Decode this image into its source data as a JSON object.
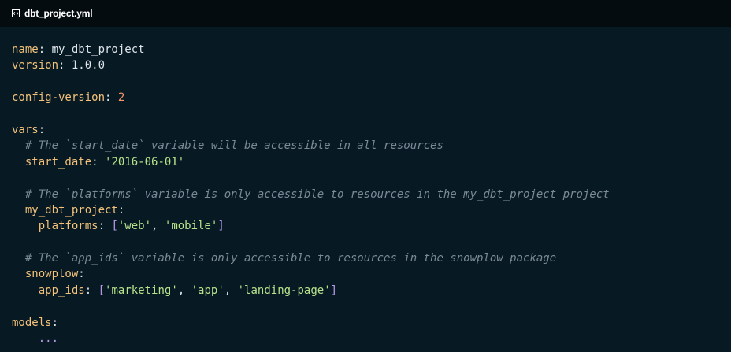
{
  "tab": {
    "icon": "code-file-icon",
    "filename": "dbt_project.yml"
  },
  "code": {
    "name_key": "name",
    "name_value": "my_dbt_project",
    "version_key": "version",
    "version_value": "1.0.0",
    "config_version_key": "config-version",
    "config_version_value": "2",
    "vars_key": "vars",
    "comment_start_date": "# The `start_date` variable will be accessible in all resources",
    "start_date_key": "start_date",
    "start_date_value": "'2016-06-01'",
    "comment_platforms": "# The `platforms` variable is only accessible to resources in the my_dbt_project project",
    "project_key": "my_dbt_project",
    "platforms_key": "platforms",
    "platforms_values": [
      "'web'",
      "'mobile'"
    ],
    "comment_app_ids": "# The `app_ids` variable is only accessible to resources in the snowplow package",
    "snowplow_key": "snowplow",
    "app_ids_key": "app_ids",
    "app_ids_values": [
      "'marketing'",
      "'app'",
      "'landing-page'"
    ],
    "models_key": "models",
    "ellipsis": "..."
  },
  "colors": {
    "background": "#071a24",
    "tab_bar": "#050c10",
    "key": "#f4c27a",
    "string": "#b7e28b",
    "number": "#f79668",
    "comment": "#7b8a96",
    "bracket": "#b897e8"
  }
}
